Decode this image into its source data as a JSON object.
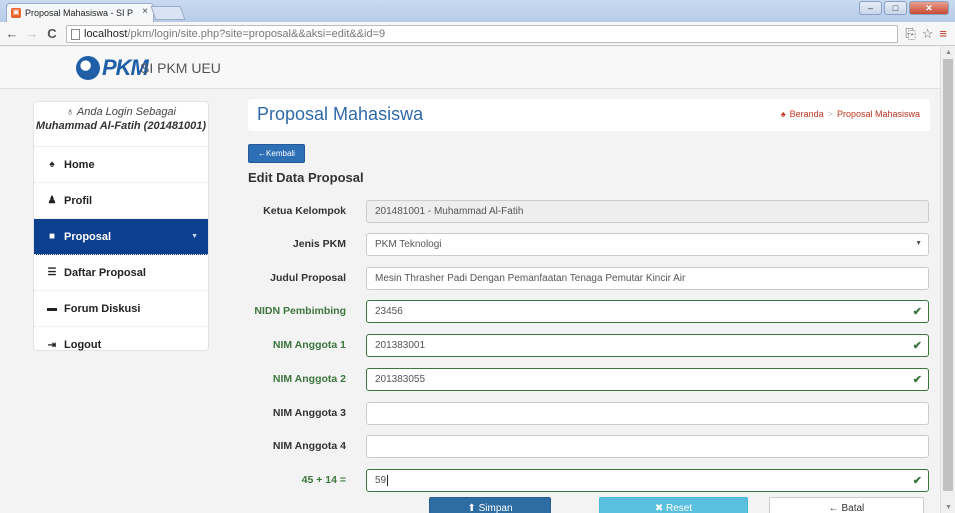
{
  "browser": {
    "tab_title": "Proposal Mahasiswa - SI P",
    "tab_close": "×",
    "url_host": "localhost",
    "url_path": "/pkm/login/site.php?site=proposal&&aksi=edit&&id=9",
    "icons": [
      "back-icon",
      "forward-icon",
      "reload-icon",
      "page-icon",
      "translate-icon",
      "star-icon",
      "menu-icon"
    ]
  },
  "topnav": {
    "logo_text": "PKM",
    "brand": "SI PKM UEU"
  },
  "sidebar": {
    "login_label": "Anda Login Sebagai",
    "user": "Muhammad Al-Fatih (201481001)",
    "items": [
      {
        "label": "Home",
        "icon": "home-icon"
      },
      {
        "label": "Profil",
        "icon": "user-icon"
      },
      {
        "label": "Proposal",
        "icon": "book-icon",
        "active": true
      },
      {
        "label": "Daftar Proposal",
        "icon": "list-icon"
      },
      {
        "label": "Forum Diskusi",
        "icon": "comment-icon"
      },
      {
        "label": "Logout",
        "icon": "logout-icon"
      }
    ]
  },
  "main": {
    "title": "Proposal Mahasiswa",
    "breadcrumb": [
      "Beranda",
      "Proposal Mahasiswa"
    ],
    "back_button": "Kembali",
    "form_title": "Edit Data Proposal",
    "fields": [
      {
        "label": "Ketua Kelompok",
        "value": "201481001 - Muhammad Al-Fatih"
      },
      {
        "label": "Jenis PKM",
        "value": "PKM Teknologi"
      },
      {
        "label": "Judul Proposal",
        "value": "Mesin Thrasher Padi Dengan Pemanfaatan Tenaga Pemutar Kincir Air"
      },
      {
        "label": "NIDN Pembimbing",
        "value": "23456"
      },
      {
        "label": "NIM Anggota 1",
        "value": "201383001"
      },
      {
        "label": "NIM Anggota 2",
        "value": "201383055"
      },
      {
        "label": "NIM Anggota 3",
        "value": ""
      },
      {
        "label": "NIM Anggota 4",
        "value": ""
      },
      {
        "label": "45 + 14 =",
        "value": "59"
      }
    ],
    "buttons": {
      "save": "Simpan",
      "reset": "Reset",
      "cancel": "Batal"
    }
  },
  "colors": {
    "accent": "#0d3f8f",
    "success": "#3c763d",
    "breadcrumb": "#c03520"
  }
}
